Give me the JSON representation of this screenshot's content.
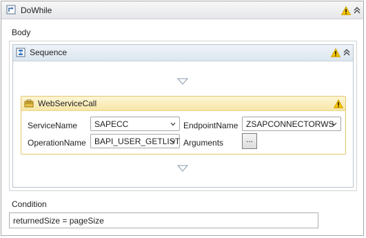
{
  "dowhile": {
    "title": "DoWhile",
    "icon": "dowhile-activity-icon"
  },
  "body_label": "Body",
  "sequence": {
    "title": "Sequence",
    "icon": "sequence-activity-icon"
  },
  "webservicecall": {
    "title": "WebServiceCall",
    "icon": "webservicecall-activity-icon",
    "service_name_label": "ServiceName",
    "service_name_value": "SAPECC",
    "endpoint_name_label": "EndpointName",
    "endpoint_name_value": "ZSAPCONNECTORWS",
    "operation_name_label": "OperationName",
    "operation_name_value": "BAPI_USER_GETLIST",
    "arguments_label": "Arguments",
    "arguments_button_label": "..."
  },
  "condition": {
    "label": "Condition",
    "value": "returnedSize = pageSize"
  },
  "colors": {
    "warning": "#f5c400",
    "header_gray": "#e5e7ea",
    "sequence_blue": "#dde6ef",
    "activity_yellow": "#f7e6a6"
  }
}
